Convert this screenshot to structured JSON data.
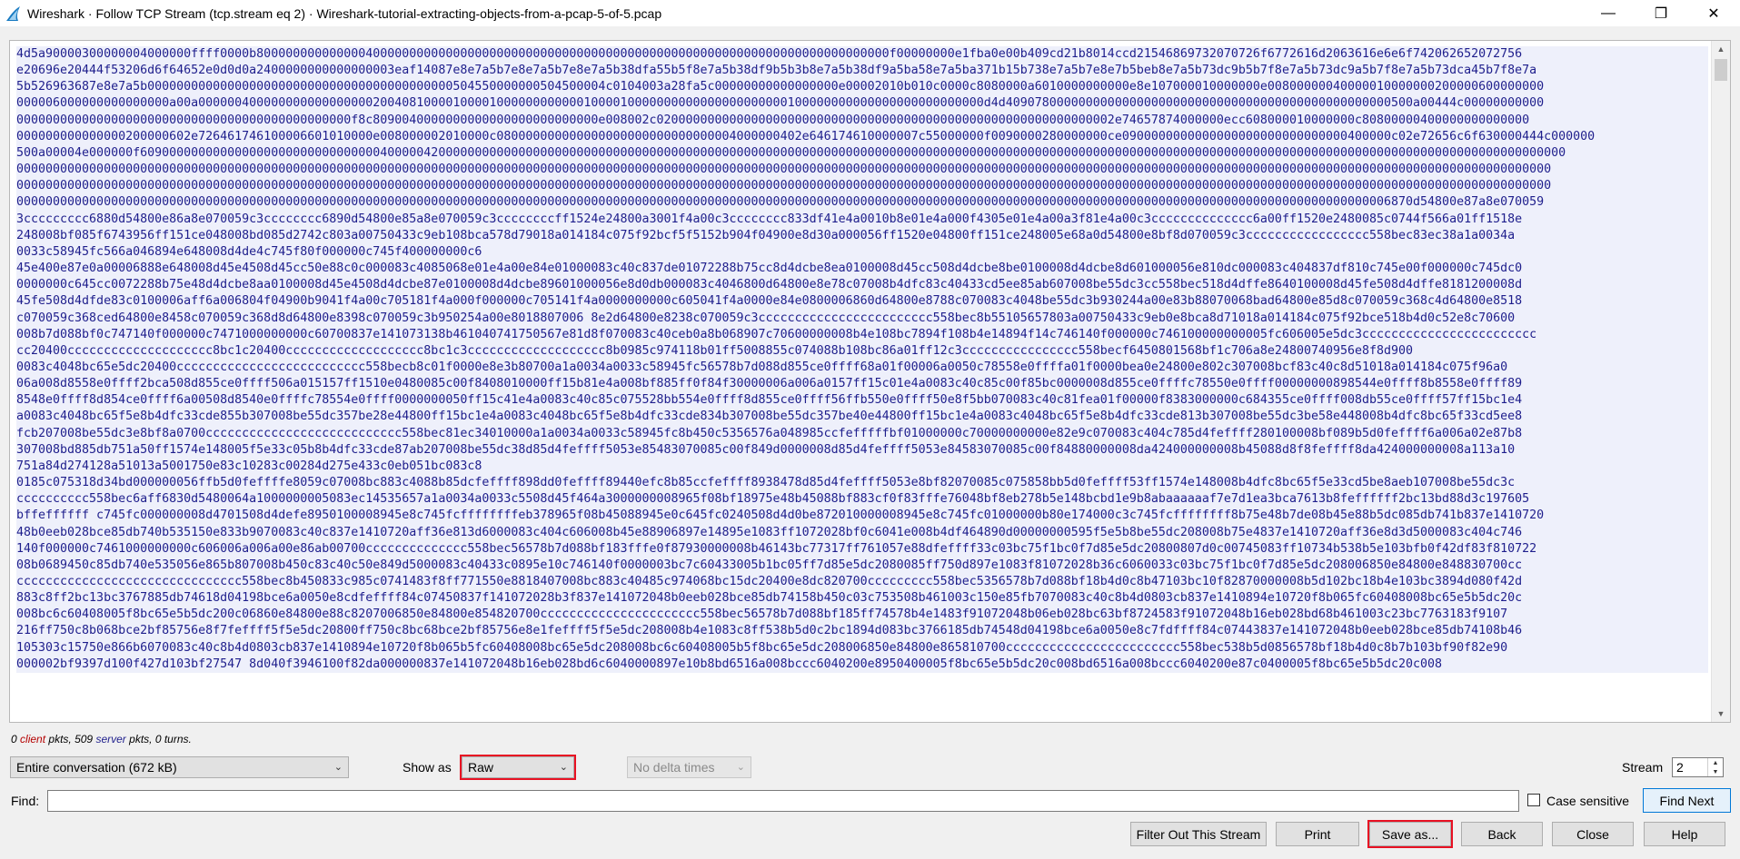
{
  "window": {
    "title": "Wireshark · Follow TCP Stream (tcp.stream eq 2) · Wireshark-tutorial-extracting-objects-from-a-pcap-5-of-5.pcap",
    "minimize": "—",
    "maximize": "❐",
    "close": "✕"
  },
  "colors": {
    "server_text": "#1e1e8c",
    "client_text": "#b40000",
    "server_bg": "#eef0fb",
    "highlight": "#e81123"
  },
  "stream": {
    "blocks": [
      [
        "4d5a90000300000004000000ffff0000b800000000000000400000000000000000000000000000000000000000000000000000000000000000000000f00000000e1fba0e00b409cd21b8014ccd21546869732070726f6772616d2063616e6e6f742062652072756",
        "e20696e20444f53206d6f64652e0d0d0a2400000000000000003eaf14087e8e7a5b7e8e7a5b7e8e7a5b38dfa55b5f8e7a5b38df9b5b3b8e7a5b38df9a5ba58e7a5ba371b15b738e7a5b7e8e7b5beb8e7a5b73dc9b5b7f8e7a5b73dc9a5b7f8e7a5b73dca45b7f8e7a",
        "5b526963687e8e7a5b000000000000000000000000000000000000000000504550000000504500004c0104003a28fa5c00000000000000000e00002010b010c0000c8080000a6010000000000e8e107000010000000e00800000040000010000000200000600000000",
        "000006000000000000000a00a000000400000000000000000200408100001000010000000000001000010000000000000000000000100000000000000000000000000d4d40907800000000000000000000000000000000000000000000000500a00444c00000000000",
        "0000000000000000000000000000000000000000000000f8c8090040000000000000000000000000e008002c020000000000000000000000000000000000000000000000000000000000002e74657874000000ecc608000010000000c80800000400000000000000",
        "000000000000000200000602e726461746100006601010000e008000002010000c080000000000000000000000000000004000000402e646174610000007c55000000f0090000280000000ce0900000000000000000000000000000400000c02e72656c6f630000444c000000",
        "500a00004e000000f6090000000000000000000000000000004000004200000000000000000000000000000000000000000000000000000000000000000000000000000000000000000000000000000000000000000000000000000000000000000000000000000000000",
        "0000000000000000000000000000000000000000000000000000000000000000000000000000000000000000000000000000000000000000000000000000000000000000000000000000000000000000000000000000000000000000000000000000000000000000000",
        "0000000000000000000000000000000000000000000000000000000000000000000000000000000000000000000000000000000000000000000000000000000000000000000000000000000000000000000000000000000000000000000000000000000000000000000",
        "000000000000000000000000000000000000000000000000000000000000000000000000000000000000000000000000000000000000000000000000000000000000000000000000000000000000000000000000000000000000000000006870d54800e87a8e070059",
        "3ccccccccc6880d54800e86a8e070059c3cccccccc6890d54800e85a8e070059c3ccccccccff1524e24800a3001f4a00c3cccccccc833df41e4a0010b8e01e4a000f4305e01e4a00a3f81e4a00c3cccccccccccccc6a00ff1520e2480085c0744f566a01ff1518e",
        "248008bf085f6743956ff151ce048008bd085d2742c803a00750433c9eb108bca578d79018a014184c075f92bcf5f5152b904f04900e8d30a000056ff1520e04800ff151ce248005e68a0d54800e8bf8d070059c3ccccccccccccccccc558bec83ec38a1a0034a",
        "0033c58945fc566a046894e648008d4de4c745f80f000000c745f400000000c6"
      ],
      [
        "45e400e87e0a00006888e648008d45e4508d45cc50e88c0c000083c4085068e01e4a00e84e01000083c40c837de01072288b75cc8d4dcbe8ea0100008d45cc508d4dcbe8be0100008d4dcbe8d601000056e810dc000083c404837df810c745e00f000000c745dc0",
        "0000000c645cc0072288b75e48d4dcbe8aa0100008d45e4508d4dcbe87e0100008d4dcbe89601000056e8d0db000083c4046800d64800e8e78c07008b4dfc83c40433cd5ee85ab607008be55dc3cc558bec518d4dffe8640100008d45fe508d4dffe8181200008d",
        "45fe508d4dfde83c0100006aff6a006804f04900b9041f4a00c705181f4a000f000000c705141f4a0000000000c605041f4a0000e84e0800006860d64800e8788c070083c4048be55dc3b930244a00e83b88070068bad64800e85d8c070059c368c4d64800e8518",
        "c070059c368ced64800e8458c070059c368d8d64800e8398c070059c3b950254a00e8018807006 8e2d64800e8238c070059c3cccccccccccccccccccccccc558bec8b55105657803a00750433c9eb0e8bca8d71018a014184c075f92bce518b4d0c52e8c70600",
        "008b7d088bf0c747140f000000c7471000000000c60700837e141073138b461040741750567e81d8f070083c40ceb0a8b068907c70600000008b4e108bc7894f108b4e14894f14c746140f000000c746100000000005fc606005e5dc3cccccccccccccccccccccccc",
        "cc20400cccccccccccccccccccc8bc1c20400ccccccccccccccccccc8bc1c3ccccccccccccccccccc8b0985c974118b01ff5008855c074088b108bc86a01ff12c3cccccccccccccccc558becf6450801568bf1c706a8e24800740956e8f8d900",
        "0083c4048bc65e5dc20400cccccccccccccccccccccccccc558becb8c01f0000e8e3b80700a1a0034a0033c58945fc56578b7d088d855ce0ffff68a01f00006a0050c78558e0ffffa01f0000bea0e24800e802c307008bcf83c40c8d51018a014184c075f96a0",
        "06a008d8558e0ffff2bca508d855ce0ffff506a015157ff1510e0480085c00f8408010000ff15b81e4a008bf885ff0f84f30000006a006a0157ff15c01e4a0083c40c85c00f85bc0000008d855ce0ffffc78550e0ffff00000000898544e0ffff8b8558e0ffff89",
        "8548e0ffff8d854ce0ffff6a00508d8540e0ffffc78554e0ffff0000000050ff15c41e4a0083c40c85c075528bb554e0ffff8d855ce0ffff56ffb550e0ffff50e8f5bb070083c40c81fea01f00000f8383000000c684355ce0ffff008db55ce0ffff57ff15bc1e4",
        "a0083c4048bc65f5e8b4dfc33cde855b307008be55dc357be28e44800ff15bc1e4a0083c4048bc65f5e8b4dfc33cde834b307008be55dc357be40e44800ff15bc1e4a0083c4048bc65f5e8b4dfc33cde813b307008be55dc3be58e448008b4dfc8bc65f33cd5ee8",
        "fcb207008be55dc3e8bf8a0700ccccccccccccccccccccccccccc558bec81ec34010000a1a0034a0033c58945fc8b450c5356576a048985ccfefffffbf01000000c70000000000e82e9c070083c404c785d4feffff280100008bf089b5d0feffff6a006a02e87b8",
        "307008bd885db751a50ff1574e148005f5e33c05b8b4dfc33cde87ab207008be55dc38d85d4feffff5053e85483070085c00f849d0000008d85d4feffff5053e84583070085c00f84880000008da424000000008b45088d8f8feffff8da424000000008a113a10",
        "751a84d274128a51013a5001750e83c10283c00284d275e433c0eb051bc083c8"
      ],
      [
        "0185c075318d34bd000000056ffb5d0feffffe8059c07008bc883c4088b85dcfeffff898dd0feffff89440efc8b85ccfeffff8938478d85d4feffff5053e8bf82070085c075858bb5d0feffff53ff1574e148008b4dfc8bc65f5e33cd5be8aeb107008be55dc3c",
        "cccccccccc558bec6aff6830d5480064a1000000005083ec14535657a1a0034a0033c5508d45f464a3000000008965f08bf18975e48b45088bf883cf0f83fffe76048bf8eb278b5e148bcbd1e9b8abaaaaaaf7e7d1ea3bca7613b8feffffff2bc13bd88d3c197605",
        "bffeffffff c745fc000000008d4701508d4defe8950100008945e8c745fcffffffffeb378965f08b45088945e0c645fc0240508d4d0be872010000008945e8c745fc01000000b80e174000c3c745fcffffffff8b75e48b7de08b45e88b5dc085db741b837e1410720",
        "48b0eeb028bce85db740b535150e833b9070083c40c837e1410720aff36e813d6000083c404c606008b45e88906897e14895e1083ff1072028bf0c6041e008b4df464890d00000000595f5e5b8be55dc208008b75e4837e1410720aff36e8d3d5000083c404c746",
        "140f000000c7461000000000c606006a006a00e86ab00700cccccccccccccc558bec56578b7d088bf183fffe0f87930000008b46143bc77317ff761057e88dfeffff33c03bc75f1bc0f7d85e5dc20800807d0c00745083ff10734b538b5e103bfb0f42df83f810722",
        "08b0689450c85db740e535056e865b807008b450c83c40c50e849d5000083c40433c0895e10c746140f0000003bc7c60433005b1bc05ff7d85e5dc2080085ff750d897e1083f81072028b36c6060033c03bc75f1bc0f7d85e5dc208006850e84800e848830700cc",
        "ccccccccccccccccccccccccccccccc558bec8b450833c985c0741483f8ff771550e8818407008bc883c40485c974068bc15dc20400e8dc820700ccccccccc558bec5356578b7d088bf18b4d0c8b47103bc10f82870000008b5d102bc18b4e103bc3894d080f42d",
        "883c8ff2bc13bc3767885db74618d04198bce6a0050e8cdfeffff84c07450837f141072028b3f837e141072048b0eeb028bce85db74158b450c03c753508b461003c150e85fb7070083c40c8b4d0803cb837e1410894e10720f8b065fc60408008bc65e5b5dc20c",
        "008bc6c60408005f8bc65e5b5dc200c06860e84800e88c8207006850e84800e854820700cccccccccccccccccccccc558bec56578b7d088bf185ff74578b4e1483f91072048b06eb028bc63bf8724583f91072048b16eb028bd68b461003c23bc7763183f9107",
        "216ff750c8b068bce2bf85756e8f7feffff5f5e5dc20800ff750c8bc68bce2bf85756e8e1feffff5f5e5dc208008b4e1083c8ff538b5d0c2bc1894d083bc3766185db74548d04198bce6a0050e8c7fdffff84c07443837e141072048b0eeb028bce85db74108b46",
        "105303c15750e866b6070083c40c8b4d0803cb837e1410894e10720f8b065b5fc60408008bc65e5dc208008bc6c60408005b5f8bc65e5dc208006850e84800e865810700cccccccccccccccccccccccc558bec538b5d0856578bf18b4d0c8b7b103bf90f82e90",
        "000002bf9397d100f427d103bf27547 8d040f3946100f82da000000837e141072048b16eb028bd6c6040000897e10b8bd6516a008bccc6040200e8950400005f8bc65e5b5dc20c008bd6516a008bccc6040200e87c0400005f8bc65e5b5dc20c008"
      ]
    ]
  },
  "summary": {
    "client_count": "0",
    "client_word": "client",
    "client_suffix": "pkts,",
    "server_count": "509",
    "server_word": "server",
    "server_suffix": "pkts, 0 turns."
  },
  "controls": {
    "conversation_select": "Entire conversation (672 kB)",
    "show_as_label": "Show as",
    "show_as_value": "Raw",
    "delta_times": "No delta times",
    "stream_label": "Stream",
    "stream_value": "2",
    "find_label": "Find:",
    "find_value": "",
    "case_sensitive_label": "Case sensitive",
    "find_next": "Find Next"
  },
  "buttons": {
    "filter_out": "Filter Out This Stream",
    "print": "Print",
    "save_as": "Save as...",
    "back": "Back",
    "close": "Close",
    "help": "Help"
  }
}
